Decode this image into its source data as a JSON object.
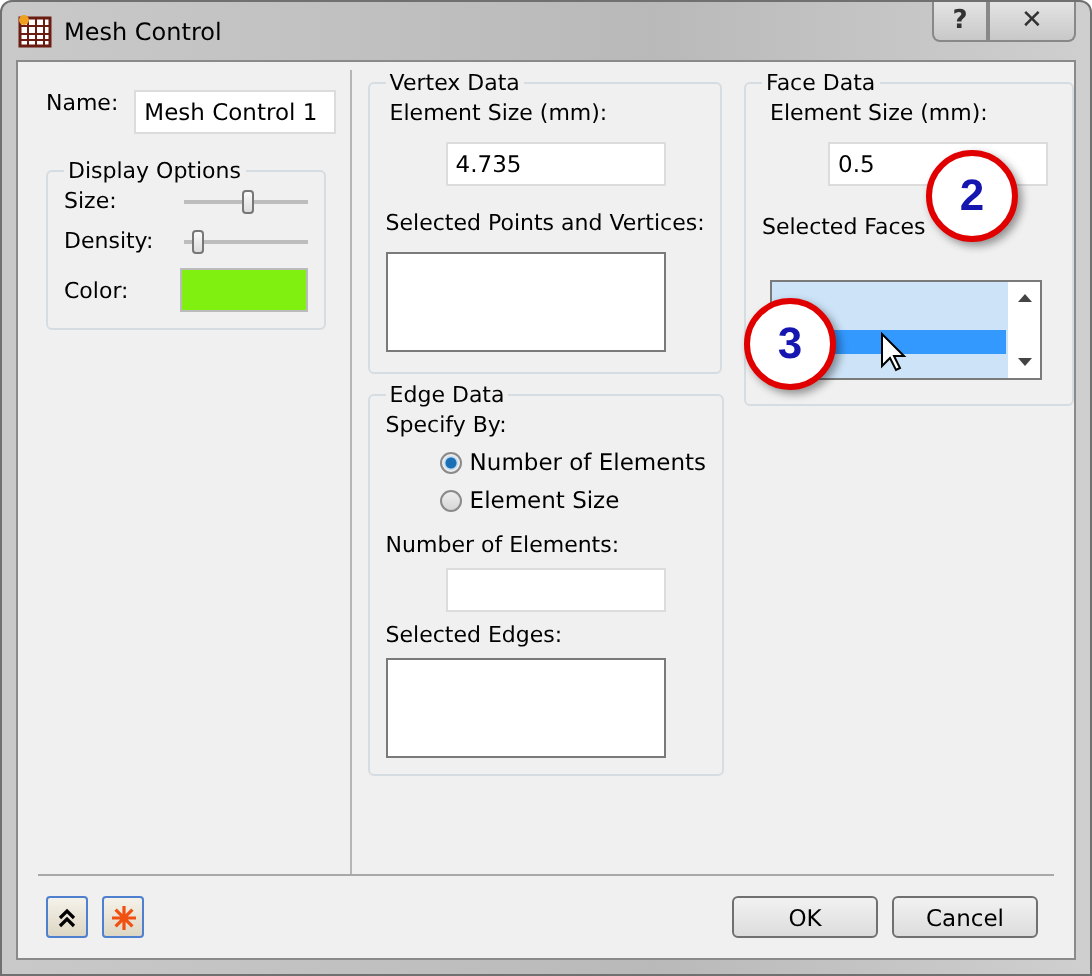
{
  "window": {
    "title": "Mesh Control",
    "help_button": "?",
    "close_button": "✕"
  },
  "name": {
    "label": "Name:",
    "value": "Mesh Control 1"
  },
  "display_options": {
    "title": "Display Options",
    "sliders": [
      {
        "label": "Size:",
        "level": 0.52
      },
      {
        "label": "Density:",
        "level": 0.12
      }
    ],
    "color": {
      "label": "Color:",
      "color": "#7ff00f"
    }
  },
  "vertex_data": {
    "title": "Vertex Data",
    "element_size_label": "Element Size (mm):",
    "element_size": "4.735",
    "selected_label": "Selected Points and Vertices:"
  },
  "edge_data": {
    "title": "Edge Data",
    "specify_label": "Specify By:",
    "options": [
      {
        "label": "Number of Elements",
        "selected": true
      },
      {
        "label": "Element Size",
        "selected": false
      }
    ],
    "count_label": "Number of Elements:",
    "selected_label": "Selected Edges:"
  },
  "face_data": {
    "title": "Face Data",
    "element_size_label": "Element Size (mm):",
    "element_size": "0.5",
    "selected_label": "Selected Faces",
    "faces": [
      {
        "selected": false
      },
      {
        "selected": true
      }
    ]
  },
  "callouts": [
    {
      "number": "2"
    },
    {
      "number": "3"
    }
  ],
  "buttons": [
    "OK",
    "Cancel"
  ]
}
